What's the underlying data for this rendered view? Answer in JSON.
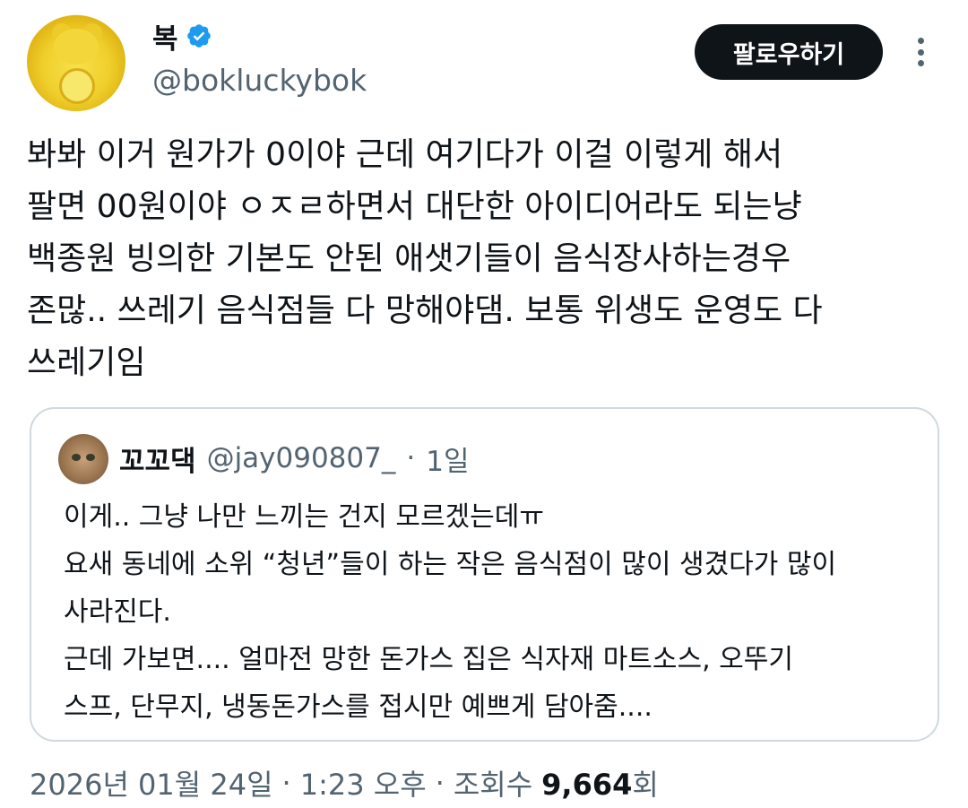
{
  "author": {
    "display_name": "복",
    "handle": "@bokluckybok",
    "verified": true
  },
  "follow_label": "팔로우하기",
  "tweet_lines": [
    "봐봐 이거 원가가 0이야 근데 여기다가 이걸 이렇게 해서",
    "팔면 00원이야 ㅇㅈㄹ하면서 대단한 아이디어라도 되는냥",
    "백종원 빙의한 기본도 안된 애샛기들이 음식장사하는경우",
    "존많.. 쓰레기 음식점들 다 망해야댐. 보통 위생도 운영도 다",
    "쓰레기임"
  ],
  "quote": {
    "display_name": "꼬꼬댁",
    "handle": "@jay090807_",
    "separator": "·",
    "time": "1일",
    "lines": [
      "이게.. 그냥 나만 느끼는 건지 모르겠는데ㅠ",
      "요새 동네에 소위 “청년”들이 하는 작은 음식점이 많이 생겼다가 많이",
      "사라진다.",
      "근데 가보면.... 얼마전 망한 돈가스 집은 식자재 마트소스, 오뚜기",
      "스프, 단무지, 냉동돈가스를 접시만 예쁘게 담아줌...."
    ]
  },
  "meta": {
    "date": "2026년 01월 24일",
    "sep1": "·",
    "time": "1:23 오후",
    "sep2": "·",
    "views_label": "조회수",
    "views_count": "9,664",
    "views_suffix": "회"
  },
  "colors": {
    "text": "#0f1419",
    "secondary": "#536471",
    "verified": "#1d9bf0",
    "border": "#cfd9de"
  },
  "icons": [
    "verified-badge-icon",
    "more-options-icon"
  ]
}
